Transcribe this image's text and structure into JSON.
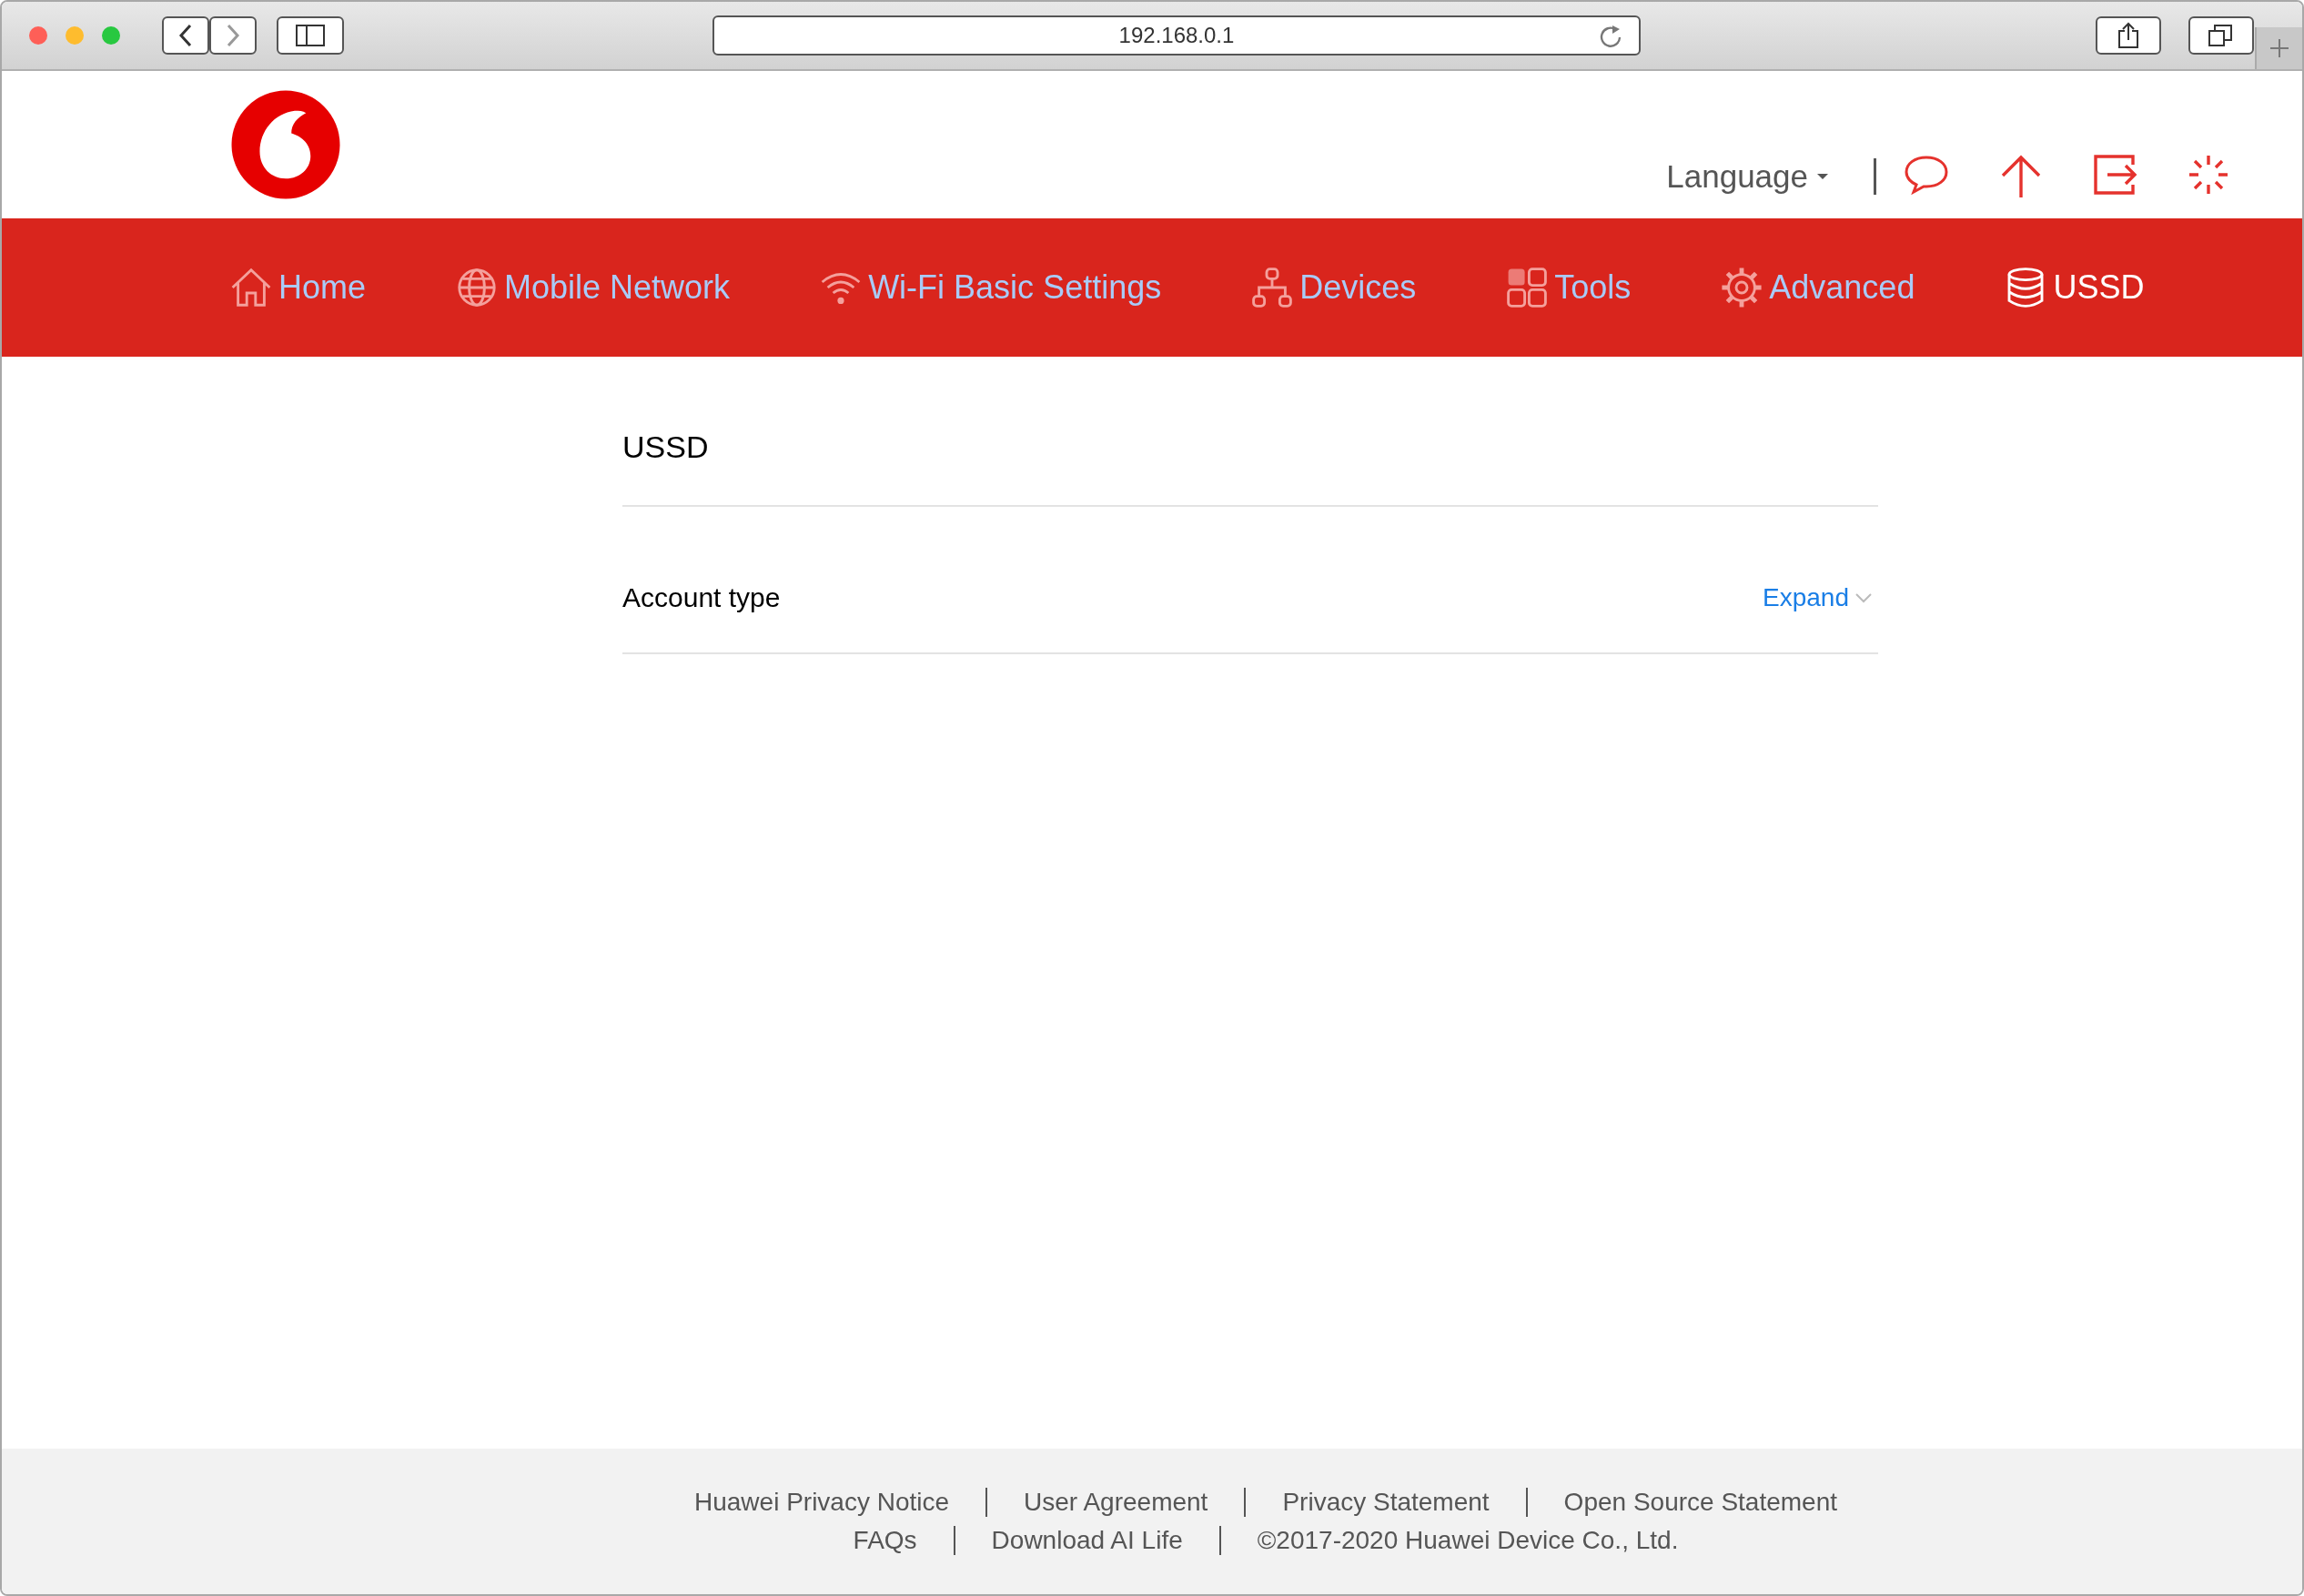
{
  "browser": {
    "url": "192.168.0.1"
  },
  "header": {
    "language": "Language"
  },
  "nav": [
    {
      "kind": "home",
      "label": "Home",
      "selected": false
    },
    {
      "kind": "globe",
      "label": "Mobile Network",
      "selected": false
    },
    {
      "kind": "wifi",
      "label": "Wi-Fi Basic Settings",
      "selected": false
    },
    {
      "kind": "devices",
      "label": "Devices",
      "selected": false
    },
    {
      "kind": "tools",
      "label": "Tools",
      "selected": false
    },
    {
      "kind": "gear",
      "label": "Advanced",
      "selected": false
    },
    {
      "kind": "database",
      "label": "USSD",
      "selected": true
    }
  ],
  "page": {
    "title": "USSD",
    "sections": [
      {
        "label": "Account type",
        "action": "Expand",
        "expanded": false
      }
    ]
  },
  "footer": {
    "rows": [
      [
        "Huawei Privacy Notice",
        "User Agreement",
        "Privacy Statement",
        "Open Source Statement"
      ],
      [
        "FAQs",
        "Download AI Life",
        "©2017-2020 Huawei Device Co., Ltd."
      ]
    ]
  }
}
